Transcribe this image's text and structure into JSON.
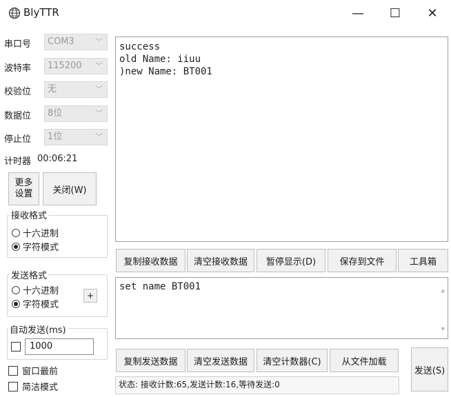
{
  "window": {
    "title": "BlyTTR",
    "minimize_glyph": "—",
    "maximize_glyph": "☐",
    "close_glyph": "✕"
  },
  "serial": {
    "port_label": "串口号",
    "port_value": "COM3",
    "baud_label": "波特率",
    "baud_value": "115200",
    "parity_label": "校验位",
    "parity_value": "无",
    "databits_label": "数据位",
    "databits_value": "8位",
    "stopbits_label": "停止位",
    "stopbits_value": "1位",
    "timer_label": "计时器",
    "timer_value": "00:06:21"
  },
  "buttons": {
    "more_settings": "更多设置",
    "close": "关闭(W)",
    "plus": "+",
    "copy_receive": "复制接收数据",
    "clear_receive": "清空接收数据",
    "pause_display": "暂停显示(D)",
    "save_file": "保存到文件",
    "toolbox": "工具箱",
    "copy_send": "复制发送数据",
    "clear_send": "清空发送数据",
    "clear_counter": "清空计数器(C)",
    "load_file": "从文件加载",
    "send": "发送(S)"
  },
  "receive_format": {
    "title": "接收格式",
    "hex_label": "十六进制",
    "text_label": "字符模式",
    "selected": "text"
  },
  "send_format": {
    "title": "发送格式",
    "hex_label": "十六进制",
    "text_label": "字符模式",
    "selected": "text"
  },
  "auto_send": {
    "label": "自动发送(ms)",
    "interval_value": "1000",
    "checked": false
  },
  "options": {
    "window_top_label": "窗口最前",
    "simple_mode_label": "简洁模式"
  },
  "receive_area": {
    "lines": [
      "success",
      "old Name: iiuu",
      ")new Name: BT001"
    ]
  },
  "send_area": {
    "text": "set name BT001"
  },
  "status": {
    "text": "状态: 接收计数:65,发送计数:16,等待发送:0"
  },
  "icons": {
    "app": "globe-icon",
    "scroll_up": "▲",
    "scroll_down": "▼",
    "combo_arrow": "﹀"
  }
}
